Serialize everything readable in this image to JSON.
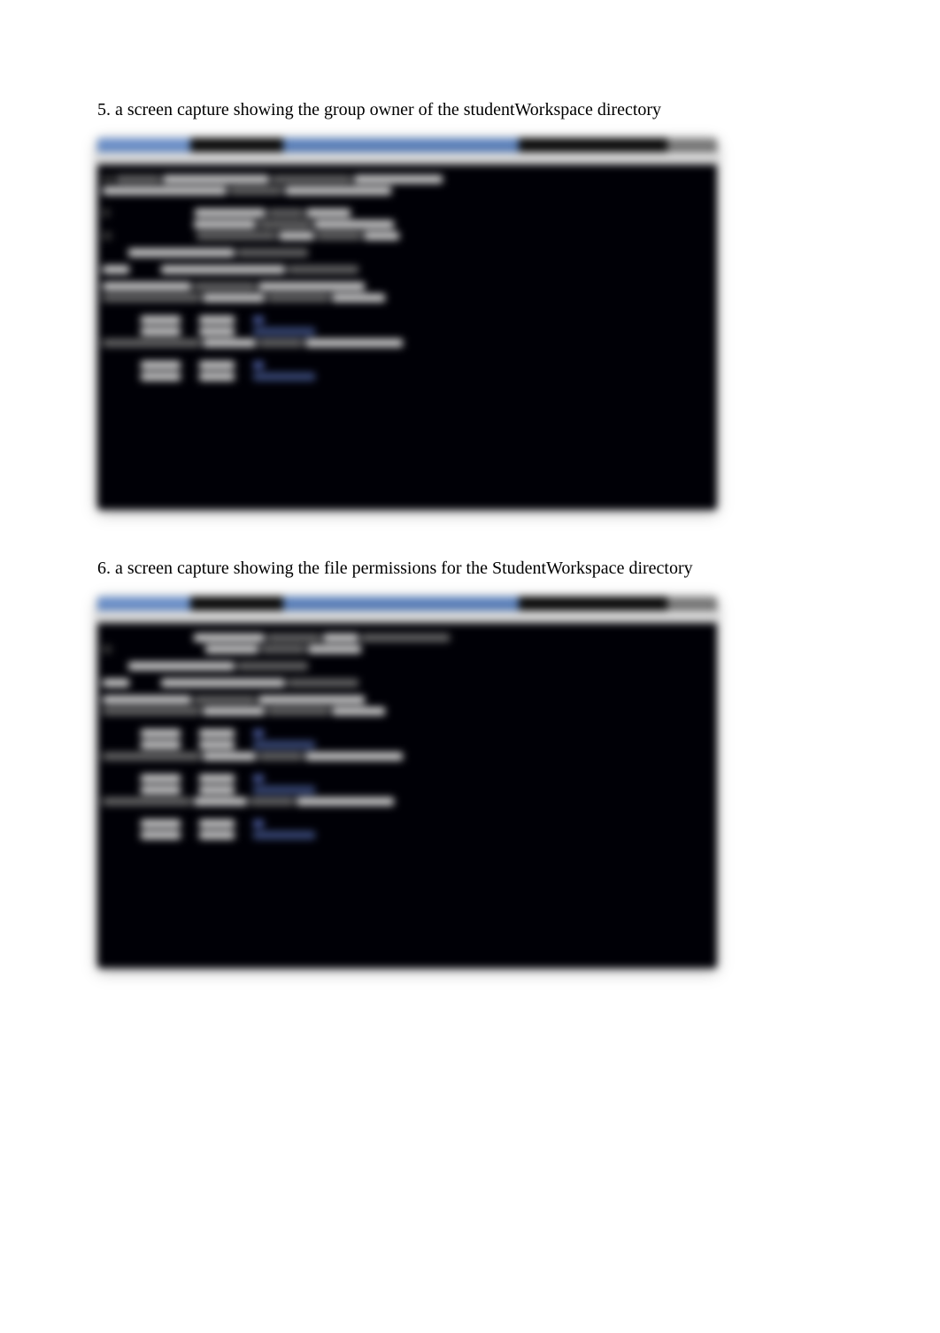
{
  "items": [
    {
      "number": "5.",
      "text": "a screen capture showing the group owner of the studentWorkspace directory"
    },
    {
      "number": "6.",
      "text": "a screen capture showing the file permissions for the StudentWorkspace directory"
    }
  ]
}
